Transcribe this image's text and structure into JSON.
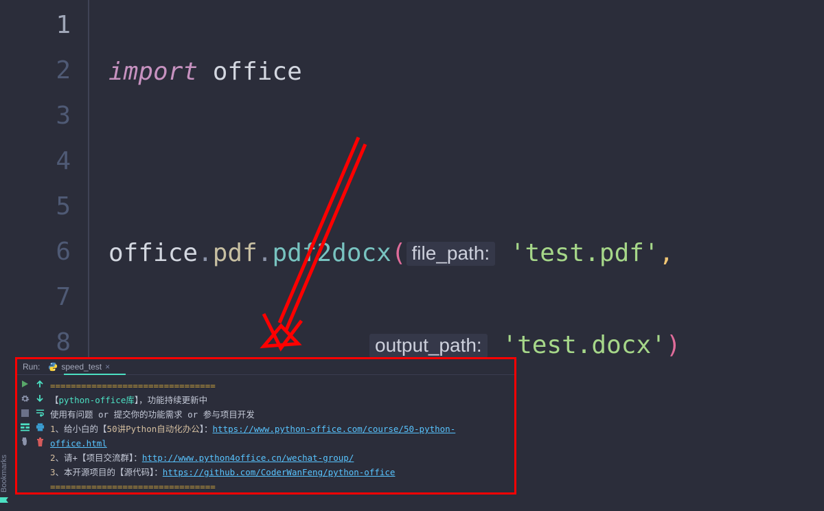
{
  "gutter": {
    "l1": "1",
    "l2": "2",
    "l3": "3",
    "l4": "4",
    "l5": "5",
    "l6": "6",
    "l7": "7",
    "l8": "8"
  },
  "code": {
    "import_kw": "import",
    "import_space": " ",
    "import_mod": "office",
    "line3_obj": "office",
    "line3_dot1": ".",
    "line3_prop": "pdf",
    "line3_dot2": ".",
    "line3_fn": "pdf2docx",
    "line3_lparen": "(",
    "hint_file": "file_path:",
    "str_test_pdf": "'test.pdf'",
    "comma": ",",
    "hint_output": "output_path:",
    "str_test_docx": "'test.docx'",
    "line4_rparen": ")"
  },
  "run": {
    "label": "Run:",
    "tab_name": "speed_test",
    "sep": "================================",
    "banner_open": "【",
    "banner_lbl": "python-office库",
    "banner_close": "】，功能持续更新中",
    "line2a": "使用有问题 ",
    "line2_or": "or",
    "line2b": " 提交你的功能需求 ",
    "line2c": " 参与项目开发",
    "n1": "1",
    "n2": "2",
    "n3": "3",
    "t1a": "、给小白的【",
    "t1b": "50讲Python自动化办公",
    "t1c": "】：",
    "url1": "https://www.python-office.com/course/50-python-office.html",
    "t2a": "、请+【项目交流群】：",
    "url2": "http://www.python4office.cn/wechat-group/",
    "t3a": "、本开源项目的【源代码】：",
    "url3": "https://github.com/CoderWanFeng/python-office"
  },
  "bookmarks_label": "Bookmarks"
}
